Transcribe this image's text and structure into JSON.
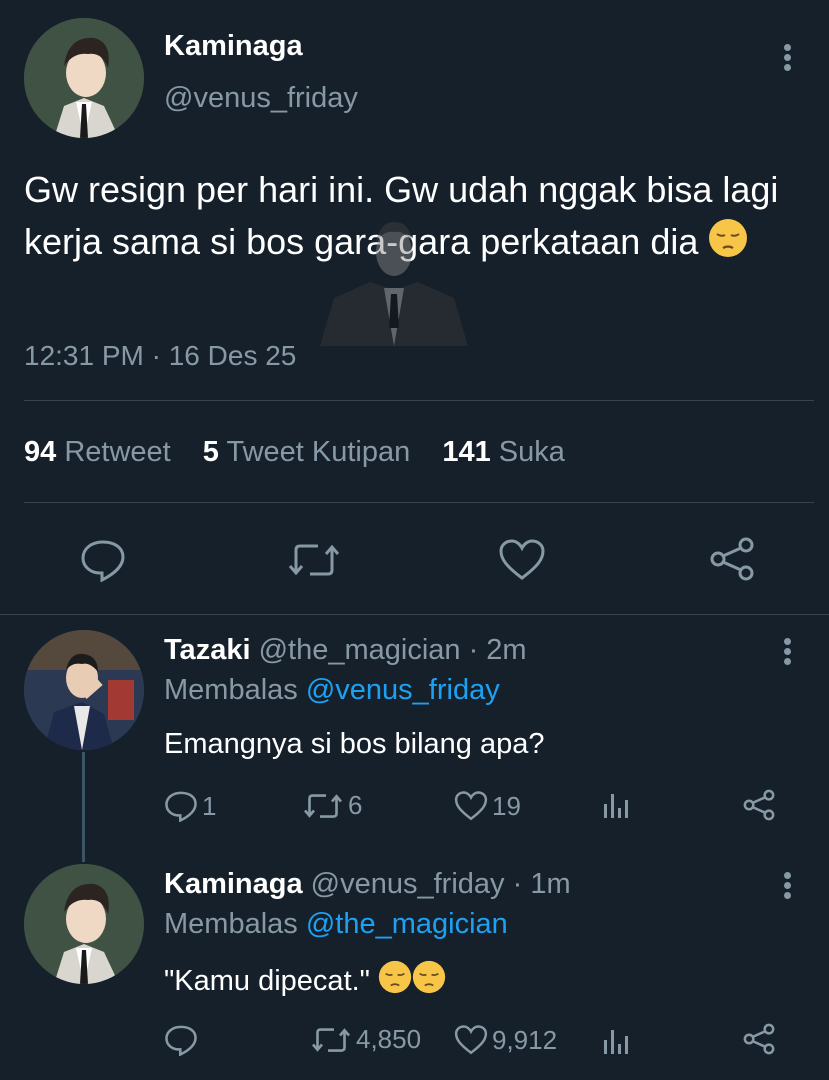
{
  "colors": {
    "background": "#15202b",
    "text_primary": "#ffffff",
    "text_secondary": "#8899a6",
    "link": "#1da1f2",
    "divider": "#38444d"
  },
  "main_tweet": {
    "display_name": "Kaminaga",
    "handle": "@venus_friday",
    "text": "Gw resign per hari ini. Gw udah nggak bisa lagi kerja sama si bos gara-gara perkataan dia",
    "emoji": "pensive-face",
    "timestamp": "12:31 PM · 16 Des 25",
    "stats": {
      "retweets_count": "94",
      "retweets_label": "Retweet",
      "quotes_count": "5",
      "quotes_label": "Tweet Kutipan",
      "likes_count": "141",
      "likes_label": "Suka"
    },
    "actions": [
      "reply-icon",
      "retweet-icon",
      "like-icon",
      "share-icon"
    ]
  },
  "replies": [
    {
      "display_name": "Tazaki",
      "handle": "@the_magician",
      "time": "· 2m",
      "replying_label": "Membalas",
      "replying_to": "@venus_friday",
      "text": "Emangnya si bos bilang apa?",
      "reply_count": "1",
      "retweet_count": "6",
      "like_count": "19"
    },
    {
      "display_name": "Kaminaga",
      "handle": "@venus_friday",
      "time": "· 1m",
      "replying_label": "Membalas",
      "replying_to": "@the_magician",
      "text": "\"Kamu dipecat.\"",
      "emoji": "pensive-face x2",
      "reply_count": "",
      "retweet_count": "4,850",
      "like_count": "9,912"
    }
  ]
}
